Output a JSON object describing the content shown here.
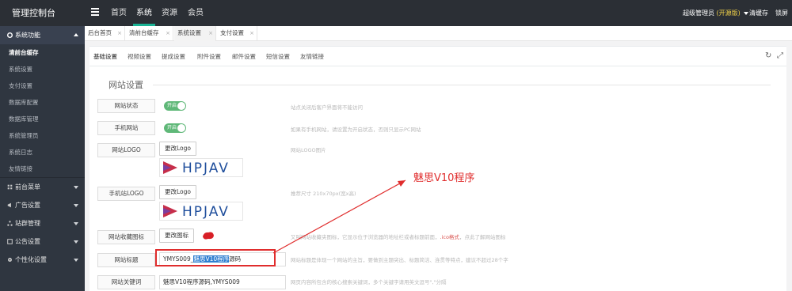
{
  "app": {
    "brand": "管理控制台"
  },
  "topnav": {
    "items": [
      "首页",
      "系统",
      "资源",
      "会员"
    ]
  },
  "topright": {
    "user": "超级管理员",
    "badge": "(开源版)",
    "clear_cache": "清缓存",
    "logout": "锁屏"
  },
  "sidebar": {
    "groups": [
      {
        "label": "系统功能",
        "open": true
      },
      {
        "label": "前台菜单"
      },
      {
        "label": "广告设置"
      },
      {
        "label": "站群管理"
      },
      {
        "label": "公告设置"
      },
      {
        "label": "个性化设置"
      }
    ],
    "items": [
      "清前台缓存",
      "系统设置",
      "支付设置",
      "数据库配置",
      "数据库管理",
      "系统管理员",
      "系统日志",
      "友情链接"
    ]
  },
  "page_tabs": [
    "后台首页",
    "清前台缓存",
    "系统设置",
    "支付设置"
  ],
  "sub_tabs": [
    "基础设置",
    "视频设置",
    "提成设置",
    "附件设置",
    "邮件设置",
    "短信设置",
    "友情链接"
  ],
  "section_title": "网站设置",
  "form": {
    "site_status": {
      "label": "网站状态",
      "toggle": "开启",
      "help": "站点关闭后客户界面将不能访问"
    },
    "mobile_site": {
      "label": "手机网站",
      "toggle": "开启",
      "help": "如果有手机网站，请设置为开启状态，否则只显示PC网站"
    },
    "site_logo": {
      "label": "网站LOGO",
      "button": "更改Logo",
      "help": "网站LOGO图片",
      "logo_text": "HPJAV"
    },
    "mobile_logo": {
      "label": "手机站LOGO",
      "button": "更改Logo",
      "help": "推荐尺寸 210x70px(宽x高)",
      "logo_text": "HPJAV"
    },
    "favicon": {
      "label": "网站收藏图标",
      "button": "更改图标",
      "help_a": "又叫网站收藏夹图标，它显示位于浏览器的地址栏或者标题前面，",
      "help_red": ".ico格式",
      "help_b": "，点此了解网站图标"
    },
    "site_title": {
      "label": "网站标题",
      "value_a": "YMYS009_",
      "value_sel": "魅思V10程序",
      "value_b": "源码",
      "help": "网站标题是体现一个网站的主旨，要做到主题突出、标题简洁、连贯等特点，建议不超过28个字"
    },
    "site_keywords": {
      "label": "网站关键词",
      "value": "魅思V10程序源码,YMYS009",
      "help": "网页内容所包含的核心搜索关键词，多个关键字请用英文逗号\",\"分隔"
    }
  },
  "annotation": {
    "text": "魅思V10程序",
    "color": "#e02d2d"
  },
  "colors": {
    "topbar": "#2b2f35",
    "sidebar": "#2f3640",
    "accent": "#1ab394",
    "toggle_on": "#5fb878"
  }
}
